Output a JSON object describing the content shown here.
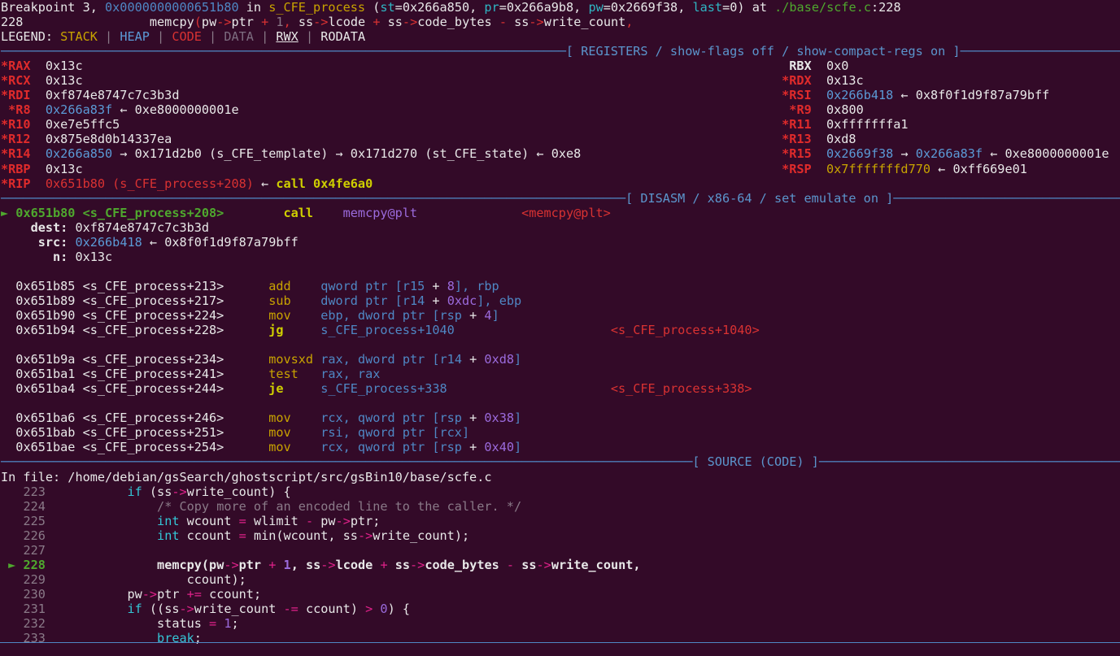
{
  "theme": {
    "background": "#330A28",
    "foreground": "#e8e8e8",
    "divider": "#4f87c4",
    "stack_color": "#c8a400",
    "heap_color": "#5b9ad6",
    "code_color": "#d93232",
    "data_color": "#8a7a88",
    "accent_red": "#e02b2b",
    "accent_green": "#4fa82e",
    "accent_yellow": "#cfcf00",
    "accent_purple": "#8a63d2",
    "accent_magenta": "#e0218a"
  },
  "breakpoint": {
    "prefix": "Breakpoint 3, ",
    "address": "0x0000000000651b80",
    "in_word": " in ",
    "function": "s_CFE_process",
    "paren_open": " (",
    "args": [
      {
        "name": "st",
        "eq": "=",
        "value": "0x266a850",
        "sep": ", "
      },
      {
        "name": "pr",
        "eq": "=",
        "value": "0x266a9b8",
        "sep": ", "
      },
      {
        "name": "pw",
        "eq": "=",
        "value": "0x2669f38",
        "sep": ", "
      },
      {
        "name": "last",
        "eq": "=",
        "value": "0",
        "sep": ""
      }
    ],
    "paren_close": ")",
    "at_word": " at ",
    "file_path": "./base/scfe.c",
    "file_sep": ":",
    "file_line": "228"
  },
  "current_line": {
    "number": "228",
    "indent": "            ",
    "code_tokens": [
      {
        "t": "memcpy",
        "c": "white-bold"
      },
      {
        "t": "(",
        "c": "red"
      },
      {
        "t": "pw",
        "c": "white"
      },
      {
        "t": "->",
        "c": "red"
      },
      {
        "t": "ptr ",
        "c": "white"
      },
      {
        "t": "+",
        "c": "red"
      },
      {
        "t": " ",
        "c": "white"
      },
      {
        "t": "1",
        "c": "gray"
      },
      {
        "t": ",",
        "c": "red"
      },
      {
        "t": " ss",
        "c": "white"
      },
      {
        "t": "->",
        "c": "red"
      },
      {
        "t": "lcode ",
        "c": "white"
      },
      {
        "t": "+",
        "c": "red"
      },
      {
        "t": " ss",
        "c": "white"
      },
      {
        "t": "->",
        "c": "red"
      },
      {
        "t": "code_bytes ",
        "c": "white"
      },
      {
        "t": "-",
        "c": "red"
      },
      {
        "t": " ss",
        "c": "white"
      },
      {
        "t": "->",
        "c": "red"
      },
      {
        "t": "write_count",
        "c": "white"
      },
      {
        "t": ",",
        "c": "red"
      }
    ]
  },
  "legend": {
    "label": "LEGEND: ",
    "items": [
      "STACK",
      "HEAP",
      "CODE",
      "DATA",
      "RWX",
      "RODATA"
    ],
    "separator": " | "
  },
  "sections": {
    "registers": "[ REGISTERS / show-flags off / show-compact-regs on ]",
    "disasm": "[ DISASM / x86-64 / set emulate on ]",
    "source": "[ SOURCE (CODE) ]"
  },
  "registers": {
    "left": [
      {
        "star": "*",
        "name": "RAX",
        "value": "0x13c",
        "value_class": "white",
        "chain": []
      },
      {
        "star": "*",
        "name": "RCX",
        "value": "0x13c",
        "value_class": "white",
        "chain": []
      },
      {
        "star": "*",
        "name": "RDI",
        "value": "0xf874e8747c7c3b3d",
        "value_class": "white",
        "chain": []
      },
      {
        "star": "*",
        "name": "R8",
        "value": "0x266a83f",
        "value_class": "heap",
        "chain": [
          {
            "arrow": "←",
            "text": "0xe8000000001e",
            "class": "white"
          }
        ]
      },
      {
        "star": "*",
        "name": "R10",
        "value": "0xe7e5ffc5",
        "value_class": "white",
        "chain": []
      },
      {
        "star": "*",
        "name": "R12",
        "value": "0x875e8d0b14337ea",
        "value_class": "white",
        "chain": []
      },
      {
        "star": "*",
        "name": "R14",
        "value": "0x266a850",
        "value_class": "heap",
        "chain": [
          {
            "arrow": "→",
            "text": "0x171d2b0 (s_CFE_template)",
            "class": "white"
          },
          {
            "arrow": "→",
            "text": "0x171d270 (st_CFE_state)",
            "class": "white"
          },
          {
            "arrow": "←",
            "text": "0xe8",
            "class": "white"
          }
        ]
      },
      {
        "star": "*",
        "name": "RBP",
        "value": "0x13c",
        "value_class": "white",
        "chain": []
      },
      {
        "star": "*",
        "name": "RIP",
        "value": "0x651b80 (s_CFE_process+208)",
        "value_class": "code",
        "chain": [
          {
            "arrow": "←",
            "text": "call 0x4fe6a0",
            "class": "callsite"
          }
        ]
      }
    ],
    "right": [
      {
        "star": " ",
        "name": "RBX",
        "value": "0x0",
        "value_class": "white",
        "chain": []
      },
      {
        "star": "*",
        "name": "RDX",
        "value": "0x13c",
        "value_class": "white",
        "chain": []
      },
      {
        "star": "*",
        "name": "RSI",
        "value": "0x266b418",
        "value_class": "heap",
        "chain": [
          {
            "arrow": "←",
            "text": "0x8f0f1d9f87a79bff",
            "class": "white"
          }
        ]
      },
      {
        "star": "*",
        "name": "R9",
        "value": "0x800",
        "value_class": "white",
        "chain": []
      },
      {
        "star": "*",
        "name": "R11",
        "value": "0xfffffffa1",
        "value_class": "white",
        "chain": []
      },
      {
        "star": "*",
        "name": "R13",
        "value": "0xd8",
        "value_class": "white",
        "chain": []
      },
      {
        "star": "*",
        "name": "R15",
        "value": "0x2669f38",
        "value_class": "heap",
        "chain": [
          {
            "arrow": "→",
            "text": "0x266a83f",
            "class": "heap"
          },
          {
            "arrow": "←",
            "text": "0xe8000000001e",
            "class": "white"
          }
        ]
      },
      {
        "star": "*",
        "name": "RSP",
        "value": "0x7fffffffd770",
        "value_class": "stack",
        "chain": [
          {
            "arrow": "←",
            "text": "0xff669e01",
            "class": "white"
          }
        ]
      }
    ]
  },
  "disasm": {
    "current": {
      "marker": "►",
      "address": "0x651b80",
      "symbol": "<s_CFE_process+208>",
      "mnemonic": "call",
      "operands": "memcpy@plt",
      "comment": "<memcpy@plt>"
    },
    "call_args": [
      {
        "label": "dest:",
        "value": "0xf874e8747c7c3b3d",
        "value_class": "white",
        "chain": []
      },
      {
        "label": "src:",
        "value": "0x266b418",
        "value_class": "heap",
        "chain": [
          {
            "arrow": "←",
            "text": "0x8f0f1d9f87a79bff",
            "class": "white"
          }
        ]
      },
      {
        "label": "n:",
        "value": "0x13c",
        "value_class": "white",
        "chain": []
      }
    ],
    "instructions": [
      {
        "address": "0x651b85",
        "symbol": "<s_CFE_process+213>",
        "mnemonic": "add",
        "mn_bold": false,
        "operands": [
          {
            "t": "qword ptr [r15 ",
            "c": "blue"
          },
          {
            "t": "+",
            "c": "white"
          },
          {
            "t": " ",
            "c": "blue"
          },
          {
            "t": "8",
            "c": "purple"
          },
          {
            "t": "], rbp",
            "c": "blue"
          }
        ],
        "comment": "",
        "blank_after": false
      },
      {
        "address": "0x651b89",
        "symbol": "<s_CFE_process+217>",
        "mnemonic": "sub",
        "mn_bold": false,
        "operands": [
          {
            "t": "dword ptr [r14 ",
            "c": "blue"
          },
          {
            "t": "+",
            "c": "white"
          },
          {
            "t": " ",
            "c": "blue"
          },
          {
            "t": "0xdc",
            "c": "purple"
          },
          {
            "t": "], ebp",
            "c": "blue"
          }
        ],
        "comment": "",
        "blank_after": false
      },
      {
        "address": "0x651b90",
        "symbol": "<s_CFE_process+224>",
        "mnemonic": "mov",
        "mn_bold": false,
        "operands": [
          {
            "t": "ebp, dword ptr [rsp ",
            "c": "blue"
          },
          {
            "t": "+",
            "c": "white"
          },
          {
            "t": " ",
            "c": "blue"
          },
          {
            "t": "4",
            "c": "purple"
          },
          {
            "t": "]",
            "c": "blue"
          }
        ],
        "comment": "",
        "blank_after": false
      },
      {
        "address": "0x651b94",
        "symbol": "<s_CFE_process+228>",
        "mnemonic": "jg",
        "mn_bold": true,
        "operands": [
          {
            "t": "s_CFE_process+1040",
            "c": "blue"
          }
        ],
        "comment": "<s_CFE_process+1040>",
        "blank_after": true
      },
      {
        "address": "0x651b9a",
        "symbol": "<s_CFE_process+234>",
        "mnemonic": "movsxd",
        "mn_bold": false,
        "operands": [
          {
            "t": "rax, dword ptr [r14 ",
            "c": "blue"
          },
          {
            "t": "+",
            "c": "white"
          },
          {
            "t": " ",
            "c": "blue"
          },
          {
            "t": "0xd8",
            "c": "purple"
          },
          {
            "t": "]",
            "c": "blue"
          }
        ],
        "comment": "",
        "blank_after": false
      },
      {
        "address": "0x651ba1",
        "symbol": "<s_CFE_process+241>",
        "mnemonic": "test",
        "mn_bold": false,
        "operands": [
          {
            "t": "rax, rax",
            "c": "blue"
          }
        ],
        "comment": "",
        "blank_after": false
      },
      {
        "address": "0x651ba4",
        "symbol": "<s_CFE_process+244>",
        "mnemonic": "je",
        "mn_bold": true,
        "operands": [
          {
            "t": "s_CFE_process+338",
            "c": "blue"
          }
        ],
        "comment": "<s_CFE_process+338>",
        "blank_after": true
      },
      {
        "address": "0x651ba6",
        "symbol": "<s_CFE_process+246>",
        "mnemonic": "mov",
        "mn_bold": false,
        "operands": [
          {
            "t": "rcx, qword ptr [rsp ",
            "c": "blue"
          },
          {
            "t": "+",
            "c": "white"
          },
          {
            "t": " ",
            "c": "blue"
          },
          {
            "t": "0x38",
            "c": "purple"
          },
          {
            "t": "]",
            "c": "blue"
          }
        ],
        "comment": "",
        "blank_after": false
      },
      {
        "address": "0x651bab",
        "symbol": "<s_CFE_process+251>",
        "mnemonic": "mov",
        "mn_bold": false,
        "operands": [
          {
            "t": "rsi, qword ptr [rcx]",
            "c": "blue"
          }
        ],
        "comment": "",
        "blank_after": false
      },
      {
        "address": "0x651bae",
        "symbol": "<s_CFE_process+254>",
        "mnemonic": "mov",
        "mn_bold": false,
        "operands": [
          {
            "t": "rcx, qword ptr [rsp ",
            "c": "blue"
          },
          {
            "t": "+",
            "c": "white"
          },
          {
            "t": " ",
            "c": "blue"
          },
          {
            "t": "0x40",
            "c": "purple"
          },
          {
            "t": "]",
            "c": "blue"
          }
        ],
        "comment": "",
        "blank_after": false
      }
    ]
  },
  "source": {
    "file_label": "In file: ",
    "file_path": "/home/debian/gsSearch/ghostscript/src/gsBin10/base/scfe.c",
    "lines": [
      {
        "num": "223",
        "current": false,
        "tokens": [
          {
            "t": "        ",
            "c": "white"
          },
          {
            "t": "if",
            "c": "cyan"
          },
          {
            "t": " (ss",
            "c": "white"
          },
          {
            "t": "->",
            "c": "magenta"
          },
          {
            "t": "write_count) {",
            "c": "white"
          }
        ]
      },
      {
        "num": "224",
        "current": false,
        "tokens": [
          {
            "t": "            ",
            "c": "white"
          },
          {
            "t": "/* Copy more of an encoded line to the caller. */",
            "c": "comment"
          }
        ]
      },
      {
        "num": "225",
        "current": false,
        "tokens": [
          {
            "t": "            ",
            "c": "white"
          },
          {
            "t": "int",
            "c": "cyan"
          },
          {
            "t": " wcount ",
            "c": "white"
          },
          {
            "t": "=",
            "c": "magenta"
          },
          {
            "t": " wlimit ",
            "c": "white"
          },
          {
            "t": "-",
            "c": "magenta"
          },
          {
            "t": " pw",
            "c": "white"
          },
          {
            "t": "->",
            "c": "magenta"
          },
          {
            "t": "ptr;",
            "c": "white"
          }
        ]
      },
      {
        "num": "226",
        "current": false,
        "tokens": [
          {
            "t": "            ",
            "c": "white"
          },
          {
            "t": "int",
            "c": "cyan"
          },
          {
            "t": " ccount ",
            "c": "white"
          },
          {
            "t": "=",
            "c": "magenta"
          },
          {
            "t": " min(wcount, ss",
            "c": "white"
          },
          {
            "t": "->",
            "c": "magenta"
          },
          {
            "t": "write_count);",
            "c": "white"
          }
        ]
      },
      {
        "num": "227",
        "current": false,
        "tokens": [
          {
            "t": "",
            "c": "white"
          }
        ]
      },
      {
        "num": "228",
        "current": true,
        "tokens": [
          {
            "t": "            ",
            "c": "whiteb"
          },
          {
            "t": "memcpy(pw",
            "c": "whiteb"
          },
          {
            "t": "->",
            "c": "magenta"
          },
          {
            "t": "ptr ",
            "c": "whiteb"
          },
          {
            "t": "+",
            "c": "magenta"
          },
          {
            "t": " ",
            "c": "whiteb"
          },
          {
            "t": "1",
            "c": "purpleb"
          },
          {
            "t": ", ss",
            "c": "whiteb"
          },
          {
            "t": "->",
            "c": "magenta"
          },
          {
            "t": "lcode ",
            "c": "whiteb"
          },
          {
            "t": "+",
            "c": "magenta"
          },
          {
            "t": " ss",
            "c": "whiteb"
          },
          {
            "t": "->",
            "c": "magenta"
          },
          {
            "t": "code_bytes ",
            "c": "whiteb"
          },
          {
            "t": "-",
            "c": "magenta"
          },
          {
            "t": " ss",
            "c": "whiteb"
          },
          {
            "t": "->",
            "c": "magenta"
          },
          {
            "t": "write_count,",
            "c": "whiteb"
          }
        ]
      },
      {
        "num": "229",
        "current": false,
        "tokens": [
          {
            "t": "                ccount);",
            "c": "white"
          }
        ]
      },
      {
        "num": "230",
        "current": false,
        "tokens": [
          {
            "t": "        ",
            "c": "white"
          },
          {
            "t": "pw",
            "c": "white"
          },
          {
            "t": "->",
            "c": "magenta"
          },
          {
            "t": "ptr ",
            "c": "white"
          },
          {
            "t": "+=",
            "c": "magenta"
          },
          {
            "t": " ccount;",
            "c": "white"
          }
        ]
      },
      {
        "num": "231",
        "current": false,
        "tokens": [
          {
            "t": "        ",
            "c": "white"
          },
          {
            "t": "if",
            "c": "cyan"
          },
          {
            "t": " ((ss",
            "c": "white"
          },
          {
            "t": "->",
            "c": "magenta"
          },
          {
            "t": "write_count ",
            "c": "white"
          },
          {
            "t": "-=",
            "c": "magenta"
          },
          {
            "t": " ccount) ",
            "c": "white"
          },
          {
            "t": ">",
            "c": "magenta"
          },
          {
            "t": " ",
            "c": "white"
          },
          {
            "t": "0",
            "c": "purple"
          },
          {
            "t": ") {",
            "c": "white"
          }
        ]
      },
      {
        "num": "232",
        "current": false,
        "tokens": [
          {
            "t": "            status ",
            "c": "white"
          },
          {
            "t": "=",
            "c": "magenta"
          },
          {
            "t": " ",
            "c": "white"
          },
          {
            "t": "1",
            "c": "purple"
          },
          {
            "t": ";",
            "c": "white"
          }
        ]
      },
      {
        "num": "233",
        "current": false,
        "tokens": [
          {
            "t": "            ",
            "c": "white"
          },
          {
            "t": "break",
            "c": "cyan"
          },
          {
            "t": ";",
            "c": "white"
          }
        ]
      }
    ]
  }
}
